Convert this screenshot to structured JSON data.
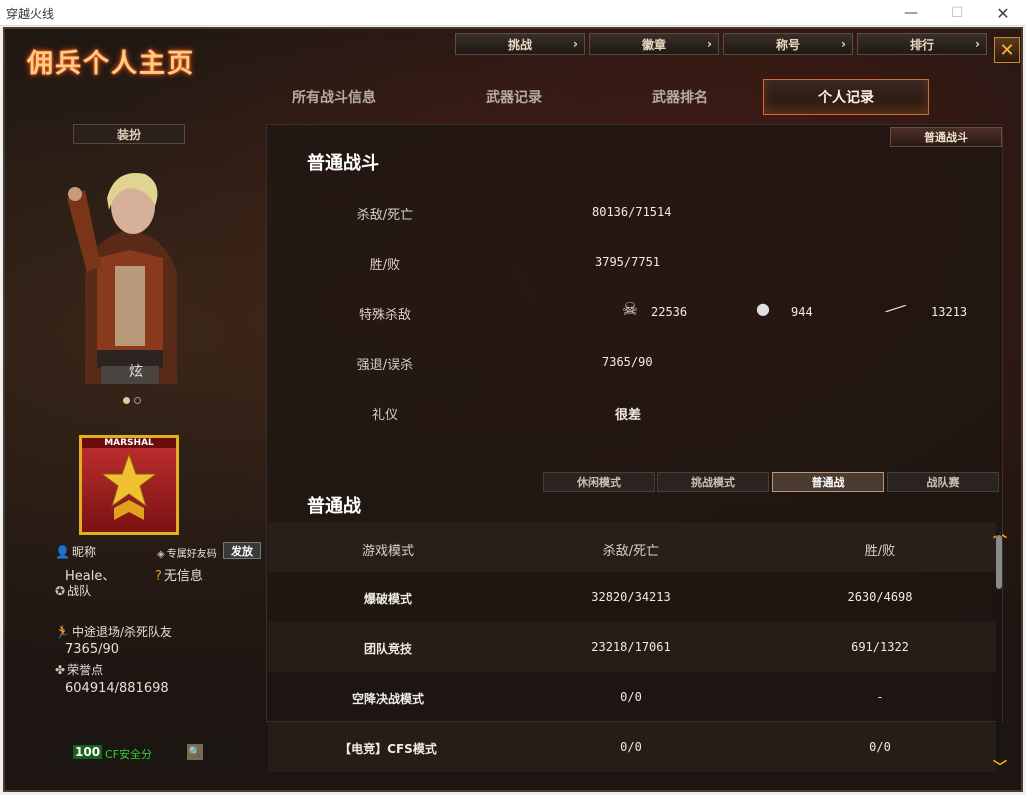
{
  "window": {
    "title": "穿越火线"
  },
  "page_title": "佣兵个人主页",
  "top_buttons": [
    {
      "label": "挑战"
    },
    {
      "label": "徽章"
    },
    {
      "label": "称号"
    },
    {
      "label": "排行"
    }
  ],
  "tabs": [
    {
      "label": "所有战斗信息",
      "active": false
    },
    {
      "label": "武器记录",
      "active": false
    },
    {
      "label": "武器排名",
      "active": false
    },
    {
      "label": "个人记录",
      "active": true
    }
  ],
  "left": {
    "costume_label": "装扮",
    "character_name": "炫",
    "rank_badge_text": "MARSHAL",
    "nickname_label": "昵称",
    "nickname_value": "Heale、",
    "friend_code_label": "专属好友码",
    "gift_button": "发放",
    "no_info": "无信息",
    "team_label": "战队",
    "quit_label": "中途退场/杀死队友",
    "quit_value": "7365/90",
    "honor_label": "荣誉点",
    "honor_value": "604914/881698",
    "security_score": "100",
    "security_label": "CF安全分"
  },
  "normal_fight": {
    "button_label": "普通战斗",
    "title": "普通战斗",
    "rows": [
      {
        "label": "杀敌/死亡",
        "value": "80136/71514"
      },
      {
        "label": "胜/败",
        "value": "3795/7751"
      },
      {
        "label": "特殊杀敌",
        "value": ""
      },
      {
        "label": "强退/误杀",
        "value": "7365/90"
      },
      {
        "label": "礼仪",
        "value": "很差"
      }
    ],
    "special_kills": [
      {
        "icon": "skull-icon",
        "value": "22536"
      },
      {
        "icon": "grenade-icon",
        "value": "944"
      },
      {
        "icon": "knife-icon",
        "value": "13213"
      }
    ]
  },
  "mode_tabs": [
    {
      "label": "休闲模式",
      "active": false
    },
    {
      "label": "挑战模式",
      "active": false
    },
    {
      "label": "普通战",
      "active": true
    },
    {
      "label": "战队赛",
      "active": false
    }
  ],
  "normal_war": {
    "title": "普通战",
    "headers": [
      "游戏模式",
      "杀敌/死亡",
      "胜/败"
    ],
    "rows": [
      {
        "mode": "爆破模式",
        "kd": "32820/34213",
        "wl": "2630/4698"
      },
      {
        "mode": "团队竞技",
        "kd": "23218/17061",
        "wl": "691/1322"
      },
      {
        "mode": "空降决战模式",
        "kd": "0/0",
        "wl": "-"
      },
      {
        "mode": "【电竞】CFS模式",
        "kd": "0/0",
        "wl": "0/0"
      }
    ]
  }
}
